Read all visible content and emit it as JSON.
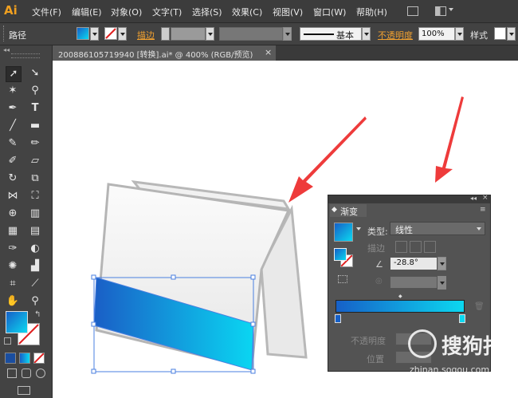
{
  "app": {
    "logo": "Ai"
  },
  "menu": [
    "文件(F)",
    "编辑(E)",
    "对象(O)",
    "文字(T)",
    "选择(S)",
    "效果(C)",
    "视图(V)",
    "窗口(W)",
    "帮助(H)"
  ],
  "control_bar": {
    "selection_label": "路径",
    "stroke_label": "描边",
    "stroke_style": "基本",
    "opacity_label": "不透明度",
    "opacity_value": "100%",
    "style_label": "样式"
  },
  "document_tab": {
    "title": "200886105719940 [转换].ai* @ 400% (RGB/预览)",
    "close": "×"
  },
  "gradient_panel": {
    "title": "渐变",
    "type_label": "类型:",
    "type_value": "线性",
    "stroke_label": "描边",
    "angle_value": "-28.8°",
    "opacity_label": "不透明度",
    "location_label": "位置",
    "gradient_colors": [
      "#1660c8",
      "#0cd8f0"
    ]
  },
  "watermark": {
    "text": "搜狗指南",
    "url": "zhinan.sogou.com"
  },
  "colors": {
    "arrow": "#ee3b3b",
    "accent": "#f0a020"
  }
}
